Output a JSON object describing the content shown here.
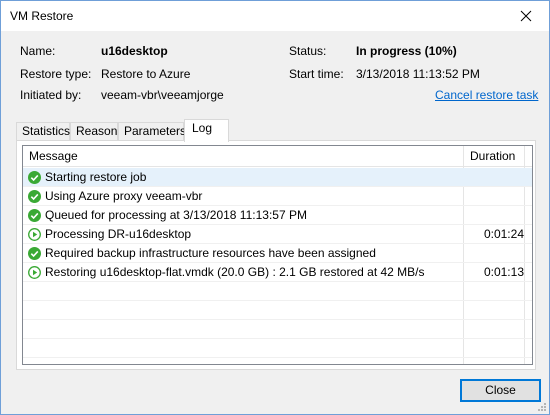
{
  "window": {
    "title": "VM Restore"
  },
  "summary": {
    "name_label": "Name:",
    "name_value": "u16desktop",
    "restore_type_label": "Restore type:",
    "restore_type_value": "Restore to Azure",
    "initiated_label": "Initiated by:",
    "initiated_value": "veeam-vbr\\veeamjorge",
    "status_label": "Status:",
    "status_value": "In progress (10%)",
    "start_time_label": "Start time:",
    "start_time_value": "3/13/2018 11:13:52 PM",
    "cancel_link": "Cancel restore task"
  },
  "tabs": [
    {
      "label": "Statistics"
    },
    {
      "label": "Reason"
    },
    {
      "label": "Parameters"
    },
    {
      "label": "Log",
      "active": true
    }
  ],
  "log": {
    "columns": {
      "message": "Message",
      "duration": "Duration"
    },
    "rows": [
      {
        "icon": "check-circle-icon",
        "message": "Starting restore job",
        "duration": ""
      },
      {
        "icon": "check-circle-icon",
        "message": "Using Azure proxy veeam-vbr",
        "duration": ""
      },
      {
        "icon": "check-circle-icon",
        "message": "Queued for processing at 3/13/2018 11:13:57 PM",
        "duration": ""
      },
      {
        "icon": "play-circle-icon",
        "message": "Processing DR-u16desktop",
        "duration": "0:01:24"
      },
      {
        "icon": "check-circle-icon",
        "message": "Required backup infrastructure resources have been assigned",
        "duration": ""
      },
      {
        "icon": "play-circle-icon",
        "message": "Restoring u16desktop-flat.vmdk (20.0 GB) : 2.1 GB restored at 42 MB/s",
        "duration": "0:01:13"
      }
    ]
  },
  "footer": {
    "close_label": "Close"
  },
  "colors": {
    "success": "#3aa935",
    "link": "#0066cc",
    "accent": "#0078d7"
  }
}
